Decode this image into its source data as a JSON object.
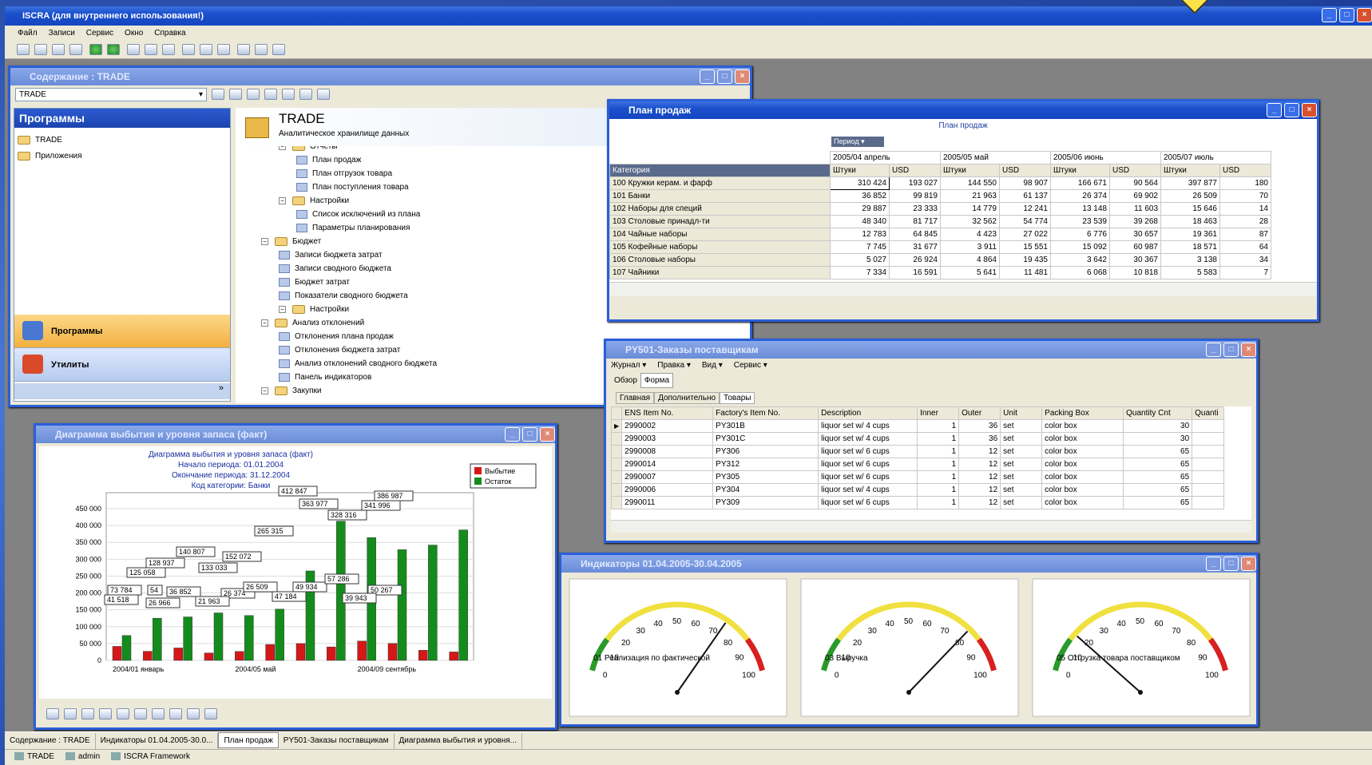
{
  "app": {
    "title": "ISCRA (для внутреннего использования!)",
    "menu": [
      "Файл",
      "Записи",
      "Сервис",
      "Окно",
      "Справка"
    ]
  },
  "contents": {
    "title": "Содержание : TRADE",
    "combo": "TRADE",
    "nav_header": "Программы",
    "nav_items": [
      "TRADE",
      "Приложения"
    ],
    "big_buttons": [
      "Программы",
      "Утилиты"
    ],
    "head_title": "TRADE",
    "head_sub": "Аналитическое хранилище данных",
    "tree": [
      {
        "label": "Отчеты",
        "lvl": 2,
        "t": "f"
      },
      {
        "label": "План продаж",
        "lvl": 3,
        "t": "r"
      },
      {
        "label": "План отгрузок товара",
        "lvl": 3,
        "t": "r"
      },
      {
        "label": "План поступления товара",
        "lvl": 3,
        "t": "r"
      },
      {
        "label": "Настройки",
        "lvl": 2,
        "t": "f"
      },
      {
        "label": "Список исключений из плана",
        "lvl": 3,
        "t": "r"
      },
      {
        "label": "Параметры планирования",
        "lvl": 3,
        "t": "r"
      },
      {
        "label": "Бюджет",
        "lvl": 1,
        "t": "f"
      },
      {
        "label": "Записи бюджета затрат",
        "lvl": 2,
        "t": "r"
      },
      {
        "label": "Записи сводного бюджета",
        "lvl": 2,
        "t": "r"
      },
      {
        "label": "Бюджет затрат",
        "lvl": 2,
        "t": "r"
      },
      {
        "label": "Показатели сводного бюджета",
        "lvl": 2,
        "t": "r"
      },
      {
        "label": "Настройки",
        "lvl": 2,
        "t": "f"
      },
      {
        "label": "Анализ отклонений",
        "lvl": 1,
        "t": "f"
      },
      {
        "label": "Отклонения плана продаж",
        "lvl": 2,
        "t": "r"
      },
      {
        "label": "Отклонения бюджета затрат",
        "lvl": 2,
        "t": "r"
      },
      {
        "label": "Анализ отклонений сводного бюджета",
        "lvl": 2,
        "t": "r"
      },
      {
        "label": "Панель индикаторов",
        "lvl": 2,
        "t": "r"
      },
      {
        "label": "Закупки",
        "lvl": 1,
        "t": "f"
      }
    ]
  },
  "plan": {
    "title": "План продаж",
    "caption": "План продаж",
    "period_btn": "Период",
    "cat_header": "Категория",
    "periods": [
      "2005/04 апрель",
      "2005/05 май",
      "2005/06 июнь",
      "2005/07 июль"
    ],
    "units": [
      "Штуки",
      "USD"
    ],
    "rows": [
      {
        "c": "100 Кружки керам. и фарф",
        "v": [
          "310 424",
          "193 027",
          "144 550",
          "98 907",
          "166 671",
          "90 564",
          "397 877",
          "180"
        ]
      },
      {
        "c": "101 Банки",
        "v": [
          "36 852",
          "99 819",
          "21 963",
          "61 137",
          "26 374",
          "69 902",
          "26 509",
          "70"
        ]
      },
      {
        "c": "102 Наборы для специй",
        "v": [
          "29 887",
          "23 333",
          "14 779",
          "12 241",
          "13 148",
          "11 603",
          "15 646",
          "14"
        ]
      },
      {
        "c": "103 Столовые принадл-ти",
        "v": [
          "48 340",
          "81 717",
          "32 562",
          "54 774",
          "23 539",
          "39 268",
          "18 463",
          "28"
        ]
      },
      {
        "c": "104 Чайные наборы",
        "v": [
          "12 783",
          "64 845",
          "4 423",
          "27 022",
          "6 776",
          "30 657",
          "19 361",
          "87"
        ]
      },
      {
        "c": "105 Кофейные наборы",
        "v": [
          "7 745",
          "31 677",
          "3 911",
          "15 551",
          "15 092",
          "60 987",
          "18 571",
          "64"
        ]
      },
      {
        "c": "106 Столовые наборы",
        "v": [
          "5 027",
          "26 924",
          "4 864",
          "19 435",
          "3 642",
          "30 367",
          "3 138",
          "34"
        ]
      },
      {
        "c": "107 Чайники",
        "v": [
          "7 334",
          "16 591",
          "5 641",
          "11 481",
          "6 068",
          "10 818",
          "5 583",
          "7"
        ]
      }
    ]
  },
  "orders": {
    "title": "PY501-Заказы поставщикам",
    "menu": [
      "Журнал ▾",
      "Правка ▾",
      "Вид ▾",
      "Сервис ▾"
    ],
    "tabs1": [
      "Обзор",
      "Форма"
    ],
    "tabs2": [
      "Главная",
      "Дополнительно",
      "Товары"
    ],
    "cols": [
      "ENS Item No.",
      "Factory's Item No.",
      "Description",
      "Inner",
      "Outer",
      "Unit",
      "Packing Box",
      "Quantity Cnt",
      "Quanti"
    ],
    "rows": [
      [
        "2990002",
        "PY301B",
        "liquor set w/ 4 cups",
        "1",
        "36",
        "set",
        "color box",
        "30"
      ],
      [
        "2990003",
        "PY301C",
        "liquor set w/ 4 cups",
        "1",
        "36",
        "set",
        "color box",
        "30"
      ],
      [
        "2990008",
        "PY306",
        "liquor set w/ 6 cups",
        "1",
        "12",
        "set",
        "color box",
        "65"
      ],
      [
        "2990014",
        "PY312",
        "liquor set w/ 6 cups",
        "1",
        "12",
        "set",
        "color box",
        "65"
      ],
      [
        "2990007",
        "PY305",
        "liquor set w/ 6 cups",
        "1",
        "12",
        "set",
        "color box",
        "65"
      ],
      [
        "2990006",
        "PY304",
        "liquor set w/ 4 cups",
        "1",
        "12",
        "set",
        "color box",
        "65"
      ],
      [
        "2990011",
        "PY309",
        "liquor set w/ 6 cups",
        "1",
        "12",
        "set",
        "color box",
        "65"
      ]
    ]
  },
  "diagram": {
    "title": "Диаграмма выбытия и уровня запаса (факт)",
    "lines": [
      "Диаграмма выбытия и уровня запаса (факт)",
      "Начало периода: 01.01.2004",
      "Окончание периода: 31.12.2004",
      "Код категории: Банки"
    ]
  },
  "chart_data": {
    "type": "bar",
    "title": "Диаграмма выбытия и уровня запаса (факт)",
    "categories": [
      "2004/01 январь",
      "2004/02",
      "2004/03",
      "2004/04",
      "2004/05 май",
      "2004/06",
      "2004/07",
      "2004/08",
      "2004/09 сентябрь",
      "2004/10",
      "2004/11",
      "2004/12"
    ],
    "x_tick_labels": [
      "2004/01 январь",
      "2004/05 май",
      "2004/09 сентябрь"
    ],
    "series": [
      {
        "name": "Выбытие",
        "color": "#d41818",
        "values": [
          41518,
          26966,
          36852,
          21963,
          26374,
          47184,
          49934,
          39943,
          57286,
          50267,
          30000,
          25000
        ]
      },
      {
        "name": "Остаток",
        "color": "#148c1c",
        "values": [
          73784,
          125058,
          128937,
          140807,
          133033,
          152072,
          265315,
          412847,
          363977,
          328316,
          341996,
          386987
        ]
      }
    ],
    "data_labels": [
      "412 847",
      "386 987",
      "363 977",
      "341 996",
      "328 316",
      "265 315",
      "152 072",
      "140 807",
      "133 033",
      "128 937",
      "125 058",
      "73 784",
      "54",
      "36 852",
      "26 374",
      "26 509",
      "49 934",
      "57 286",
      "50 267",
      "39 943",
      "47 184",
      "21 963",
      "26 966",
      "41 518"
    ],
    "yticks": [
      "450 000",
      "400 000",
      "350 000",
      "300 000",
      "250 000",
      "200 000",
      "150 000",
      "100 000",
      "50 000",
      "0"
    ],
    "ylim": [
      0,
      450000
    ],
    "legend": "top-right"
  },
  "gauges": {
    "title": "Индикаторы 01.04.2005-30.04.2005",
    "scale": [
      "0",
      "10",
      "20",
      "30",
      "40",
      "50",
      "60",
      "70",
      "80",
      "90",
      "100"
    ],
    "items": [
      {
        "label": "01 Реализация по фактической",
        "value": 73
      },
      {
        "label": "03 Выручка",
        "value": 79
      },
      {
        "label": "05 Отгрузка товара поставщиком",
        "value": 18
      }
    ]
  },
  "taskbar": [
    "Содержание : TRADE",
    "Индикаторы 01.04.2005-30.0...",
    "План продаж",
    "PY501-Заказы поставщикам",
    "Диаграмма выбытия и уровня..."
  ],
  "status": [
    "TRADE",
    "admin",
    "ISCRA Framework"
  ]
}
